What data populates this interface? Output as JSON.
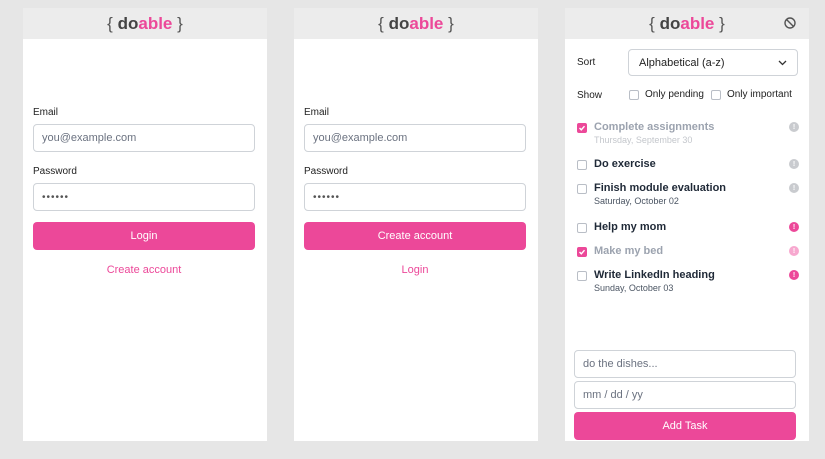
{
  "brand": {
    "open": "{",
    "do": "do",
    "able": "able",
    "close": "}"
  },
  "login_panel": {
    "email_label": "Email",
    "email_placeholder": "you@example.com",
    "password_label": "Password",
    "password_value": "••••••",
    "submit_label": "Login",
    "alt_link": "Create account"
  },
  "signup_panel": {
    "email_label": "Email",
    "email_placeholder": "you@example.com",
    "password_label": "Password",
    "password_value": "••••••",
    "submit_label": "Create account",
    "alt_link": "Login"
  },
  "tasks_panel": {
    "sort_label": "Sort",
    "sort_value": "Alphabetical (a-z)",
    "show_label": "Show",
    "filter_pending": "Only pending",
    "filter_important": "Only important",
    "tasks": [
      {
        "title": "Complete assignments",
        "date": "Thursday, September 30",
        "done": true,
        "important": false
      },
      {
        "title": "Do exercise",
        "date": "",
        "done": false,
        "important": false
      },
      {
        "title": "Finish module evaluation",
        "date": "Saturday, October 02",
        "done": false,
        "important": false
      },
      {
        "title": "Help my mom",
        "date": "",
        "done": false,
        "important": true
      },
      {
        "title": "Make my bed",
        "date": "",
        "done": true,
        "important": true
      },
      {
        "title": "Write LinkedIn heading",
        "date": "Sunday, October 03",
        "done": false,
        "important": true
      }
    ],
    "new_task_placeholder": "do the dishes...",
    "date_placeholder": "mm / dd / yy",
    "add_label": "Add Task"
  },
  "colors": {
    "accent": "#ec4899",
    "muted_prio": "#c9cbcf",
    "faded_prio": "#f7a8cf"
  }
}
